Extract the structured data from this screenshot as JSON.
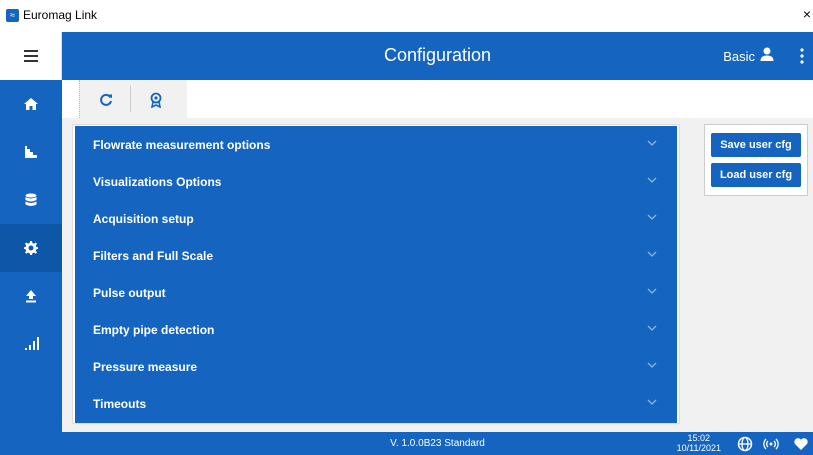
{
  "window": {
    "title": "Euromag Link",
    "close_glyph": "×",
    "app_icon": "euromag-app-icon"
  },
  "header": {
    "title": "Configuration",
    "user_mode": "Basic",
    "user_icon": "person-icon",
    "menu_icon": "kebab-icon"
  },
  "sidebar": {
    "menu_icon": "hamburger-icon",
    "items": [
      {
        "icon": "home-icon",
        "active": false
      },
      {
        "icon": "chart-icon",
        "active": false
      },
      {
        "icon": "database-icon",
        "active": false
      },
      {
        "icon": "gear-icon",
        "active": true
      },
      {
        "icon": "upload-icon",
        "active": false
      },
      {
        "icon": "signal-bars-icon",
        "active": false
      }
    ]
  },
  "toolbar": {
    "refresh_icon": "refresh-icon",
    "badge_icon": "certificate-icon"
  },
  "accordion": [
    {
      "label": "Flowrate measurement options"
    },
    {
      "label": "Visualizations Options"
    },
    {
      "label": "Acquisition setup"
    },
    {
      "label": "Filters and Full Scale"
    },
    {
      "label": "Pulse output"
    },
    {
      "label": "Empty pipe detection"
    },
    {
      "label": "Pressure measure"
    },
    {
      "label": "Timeouts"
    }
  ],
  "actions": {
    "save_label": "Save user cfg",
    "load_label": "Load user cfg"
  },
  "footer": {
    "version": "V. 1.0.0B23  Standard",
    "time": "15:02",
    "date": "10/11/2021",
    "icons": [
      "globe-icon",
      "wireless-icon",
      "heart-icon"
    ]
  },
  "colors": {
    "primary": "#1565c0",
    "active_nav": "#0d56a8",
    "content_bg": "#f1f1f1"
  }
}
